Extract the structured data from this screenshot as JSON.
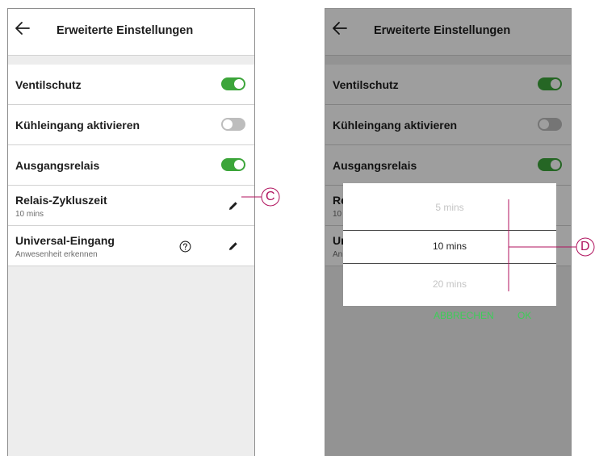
{
  "left_screen": {
    "header": {
      "title": "Erweiterte Einstellungen"
    },
    "rows": [
      {
        "label": "Ventilschutz",
        "toggle": "on"
      },
      {
        "label": "Kühleingang aktivieren",
        "toggle": "off"
      },
      {
        "label": "Ausgangsrelais",
        "toggle": "on"
      },
      {
        "label": "Relais-Zykluszeit",
        "sub": "10 mins"
      },
      {
        "label": "Universal-Eingang",
        "sub": "Anwesenheit erkennen"
      }
    ],
    "callout": "C"
  },
  "right_screen": {
    "header": {
      "title": "Erweiterte Einstellungen"
    },
    "rows": [
      {
        "label": "Ventilschutz",
        "toggle": "on"
      },
      {
        "label": "Kühleingang aktivieren",
        "toggle": "off"
      },
      {
        "label": "Ausgangsrelais",
        "toggle": "on"
      },
      {
        "label": "Re",
        "sub": "10"
      },
      {
        "label": "Ur",
        "sub": "An"
      }
    ],
    "picker": {
      "options": [
        "5 mins",
        "10 mins",
        "20 mins"
      ],
      "cancel_label": "ABBRECHEN",
      "ok_label": "OK"
    },
    "callout": "D"
  },
  "colors": {
    "toggle_on": "#3ca53a",
    "accent": "#3dcd58",
    "callout": "#b0125d"
  }
}
